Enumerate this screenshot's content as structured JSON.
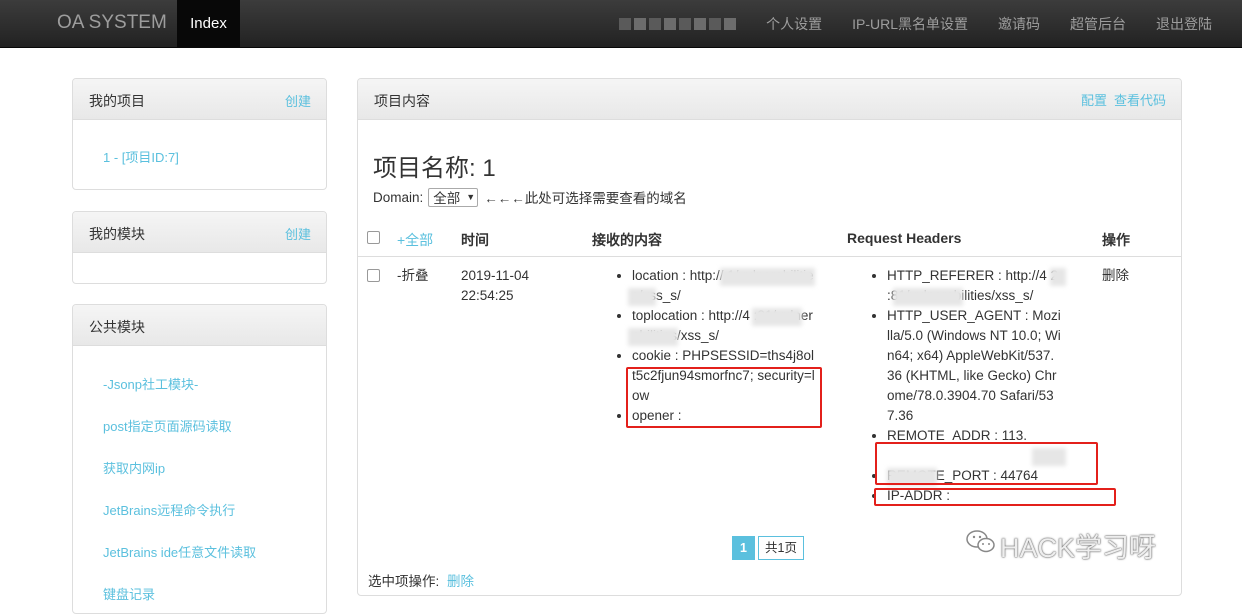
{
  "navbar": {
    "brand": "OA SYSTEM",
    "active": "Index",
    "links": [
      "个人设置",
      "IP-URL黑名单设置",
      "邀请码",
      "超管后台",
      "退出登陆"
    ]
  },
  "projects_panel": {
    "title": "我的项目",
    "action": "创建",
    "items": [
      "1 - [项目ID:7]"
    ]
  },
  "modules_panel": {
    "title": "我的模块",
    "action": "创建"
  },
  "public_panel": {
    "title": "公共模块",
    "items": [
      "-Jsonp社工模块-",
      "post指定页面源码读取",
      "获取内网ip",
      "JetBrains远程命令执行",
      "JetBrains ide任意文件读取",
      "键盘记录"
    ]
  },
  "main": {
    "panel_title": "项目内容",
    "actions": [
      "配置",
      "查看代码"
    ],
    "project_name": "项目名称: 1",
    "domain_label": "Domain:",
    "domain_value": "全部",
    "domain_hint": "←←←此处可选择需要查看的域名",
    "headers": {
      "expand": "+全部",
      "time": "时间",
      "content": "接收的内容",
      "request_headers": "Request Headers",
      "ops": "操作"
    },
    "row": {
      "collapse": "-折叠",
      "date": "2019-11-04",
      "time": "22:54:25",
      "content": [
        "location : http://        1/vulnerabilities/xss_s/",
        "toplocation : http://4    :81/vulnerabilities/xss_s/",
        "cookie : PHPSESSID=ths4j8olt5c2fjun94smorfnc7; security=low",
        "opener :"
      ],
      "request_headers": [
        "HTTP_REFERER : http://4 2       :81/vulnerabilities/xss_s/",
        "HTTP_USER_AGENT : Mozilla/5.0 (Windows NT 10.0; Win64; x64) AppleWebKit/537.36 (KHTML, like Gecko) Chrome/78.0.3904.70 Safari/537.36",
        "REMOTE_ADDR : 113.",
        "REMOTE_PORT : 44764",
        "IP-ADDR :"
      ],
      "delete": "删除"
    },
    "pager": {
      "current": "1",
      "total": "共1页"
    },
    "selected_label": "选中项操作:",
    "selected_delete": "删除"
  },
  "watermark": "HACK学习呀"
}
